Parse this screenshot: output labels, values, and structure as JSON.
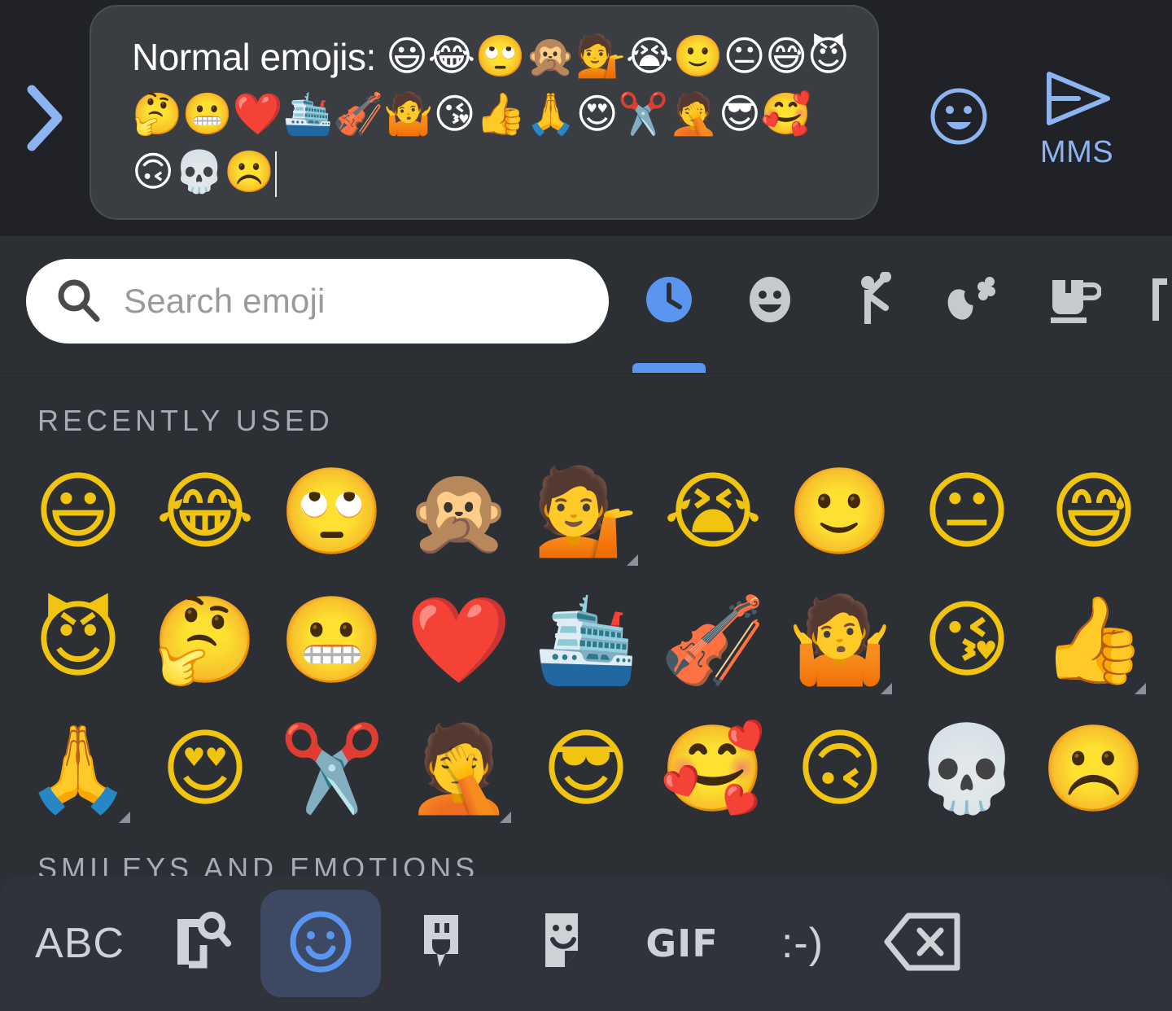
{
  "compose": {
    "expand_icon": "chevron-right-icon",
    "message_prefix": "Normal emojis: ",
    "message_emojis_line1": "😃😂🙄🙊💁😭",
    "message_emojis_line2": "🙂😐😅😈🤔😬❤️🛳️🎻🤷😘👍",
    "message_emojis_line3": "🙏😍✂️🤦😎🥰🙃💀☹️",
    "emoji_toggle_icon": "emoji-smiley-icon",
    "send_icon": "send-arrow-icon",
    "send_label": "MMS",
    "accent_blue": "#8cb4f0"
  },
  "search": {
    "icon": "search-icon",
    "placeholder": "Search emoji",
    "value": ""
  },
  "category_tabs": [
    {
      "name": "recent",
      "icon": "clock-icon",
      "active": true
    },
    {
      "name": "smileys",
      "icon": "smiley-icon",
      "active": false
    },
    {
      "name": "people",
      "icon": "person-wave-icon",
      "active": false
    },
    {
      "name": "nature",
      "icon": "nature-icon",
      "active": false
    },
    {
      "name": "food",
      "icon": "cup-icon",
      "active": false
    },
    {
      "name": "travel",
      "icon": "travel-icon",
      "active": false
    }
  ],
  "active_tab_color": "#5a96f0",
  "sections": [
    {
      "label": "RECENTLY USED",
      "emojis": [
        {
          "char": "😃",
          "name": "grinning-face-with-big-eyes",
          "variant": false
        },
        {
          "char": "😂",
          "name": "face-with-tears-of-joy",
          "variant": false
        },
        {
          "char": "🙄",
          "name": "face-with-rolling-eyes",
          "variant": false
        },
        {
          "char": "🙊",
          "name": "speak-no-evil-monkey",
          "variant": false
        },
        {
          "char": "💁",
          "name": "person-tipping-hand",
          "variant": true
        },
        {
          "char": "😭",
          "name": "loudly-crying-face",
          "variant": false
        },
        {
          "char": "🙂",
          "name": "slightly-smiling-face",
          "variant": false
        },
        {
          "char": "😐",
          "name": "neutral-face",
          "variant": false
        },
        {
          "char": "😅",
          "name": "grinning-face-with-sweat",
          "variant": false
        },
        {
          "char": "😈",
          "name": "smiling-face-with-horns",
          "variant": false
        },
        {
          "char": "🤔",
          "name": "thinking-face",
          "variant": false
        },
        {
          "char": "😬",
          "name": "grimacing-face",
          "variant": false
        },
        {
          "char": "❤️",
          "name": "red-heart",
          "variant": false
        },
        {
          "char": "🛳️",
          "name": "passenger-ship",
          "variant": false
        },
        {
          "char": "🎻",
          "name": "violin",
          "variant": false
        },
        {
          "char": "🤷",
          "name": "person-shrugging",
          "variant": true
        },
        {
          "char": "😘",
          "name": "face-blowing-a-kiss",
          "variant": false
        },
        {
          "char": "👍",
          "name": "thumbs-up",
          "variant": true
        },
        {
          "char": "🙏",
          "name": "folded-hands",
          "variant": true
        },
        {
          "char": "😍",
          "name": "smiling-face-with-heart-eyes",
          "variant": false
        },
        {
          "char": "✂️",
          "name": "scissors",
          "variant": false
        },
        {
          "char": "🤦",
          "name": "person-facepalming",
          "variant": true
        },
        {
          "char": "😎",
          "name": "smiling-face-with-sunglasses",
          "variant": false
        },
        {
          "char": "🥰",
          "name": "smiling-face-with-hearts",
          "variant": false
        },
        {
          "char": "🙃",
          "name": "upside-down-face",
          "variant": false
        },
        {
          "char": "💀",
          "name": "skull",
          "variant": false
        },
        {
          "char": "☹️",
          "name": "frowning-face",
          "variant": false
        }
      ]
    },
    {
      "label": "SMILEYS AND EMOTIONS",
      "emojis": []
    }
  ],
  "keyboard_bar": {
    "buttons": [
      {
        "name": "abc-button",
        "icon": "abc-text",
        "label": "ABC",
        "active": false
      },
      {
        "name": "clipboard-search-button",
        "icon": "clipboard-search-icon",
        "label": "",
        "active": false
      },
      {
        "name": "emoji-button",
        "icon": "emoji-smiley-icon",
        "label": "",
        "active": true
      },
      {
        "name": "emoji-sticker-button",
        "icon": "emoji-sticker-icon",
        "label": "",
        "active": false
      },
      {
        "name": "sticker-button",
        "icon": "sticker-icon",
        "label": "",
        "active": false
      },
      {
        "name": "gif-button",
        "icon": "gif-text",
        "label": "GIF",
        "active": false
      },
      {
        "name": "emoticon-button",
        "icon": "emoticon-text",
        "label": ":-)",
        "active": false
      },
      {
        "name": "backspace-button",
        "icon": "backspace-icon",
        "label": "",
        "active": false
      }
    ]
  },
  "colors": {
    "app_bg": "#212227",
    "panel_bg": "#2c2f33",
    "bubble_bg": "#3a3d42",
    "kb_bg": "#303339",
    "accent": "#5a96f0",
    "label_gray": "#a6acb3"
  }
}
